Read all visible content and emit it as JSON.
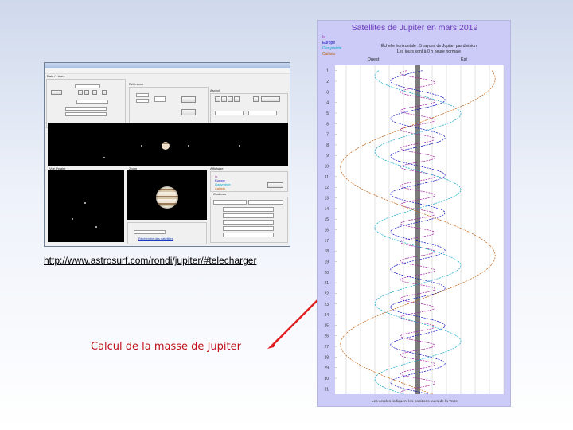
{
  "link": {
    "url_text": "http://www.astrosurf.com/rondi/jupiter/#telecharger"
  },
  "caption": {
    "text": "Calcul de la masse de Jupiter"
  },
  "arrow": {
    "color": "#e02020"
  },
  "software": {
    "tab_label": "Date / Heure",
    "group_ref": "Référence",
    "group_appearance": "Aspect",
    "pane_left": "Vue Polaire",
    "pane_right": "Zoom",
    "group_display": "Affichage",
    "legend_labels": [
      "Io",
      "Europe",
      "Ganymède",
      "Callisto"
    ],
    "legend_title": "Couleurs",
    "search_link": "Recherche des satellites",
    "field_values": [
      "31/01/2019",
      "17:00:00",
      "NIGHT VISION",
      "Réf. 23",
      "0.01 AU",
      "19h45mn",
      "6.89",
      "7.25",
      "0.9"
    ]
  },
  "chart": {
    "title": "Satellites de Jupiter en mars 2019",
    "legend": [
      {
        "label": "Io",
        "color": "#a020a0"
      },
      {
        "label": "Europe",
        "color": "#1010c0"
      },
      {
        "label": "Ganymède",
        "color": "#10a8c8"
      },
      {
        "label": "Callisto",
        "color": "#c06010"
      }
    ],
    "header_lines": [
      "Échelle horizontale : 5 rayons de Jupiter par division",
      "Les jours sont à 0 h heure normale"
    ],
    "axis_left_label": "Ouest",
    "axis_right_label": "Est",
    "days": [
      "1",
      "2",
      "3",
      "4",
      "5",
      "6",
      "7",
      "8",
      "9",
      "10",
      "11",
      "12",
      "13",
      "14",
      "15",
      "16",
      "17",
      "18",
      "19",
      "20",
      "21",
      "22",
      "23",
      "24",
      "25",
      "26",
      "27",
      "28",
      "29",
      "30",
      "31"
    ],
    "footer": "Les cercles indiquent les positions vues de la Terre"
  },
  "chart_data": {
    "type": "line",
    "title": "Satellites de Jupiter en mars 2019",
    "xlabel": "Ouest — Est",
    "ylabel": "",
    "x_units": "rayons de Jupiter",
    "y_units": "jour de mars 2019",
    "ylim": [
      1,
      31.5
    ],
    "series": [
      {
        "name": "Io",
        "color": "#a020a0",
        "amplitude": 6,
        "period_days": 1.77,
        "phase": 0.3
      },
      {
        "name": "Europe",
        "color": "#1010c0",
        "amplitude": 9.5,
        "period_days": 3.55,
        "phase": 1.2
      },
      {
        "name": "Ganymède",
        "color": "#10a8c8",
        "amplitude": 15,
        "period_days": 7.15,
        "phase": 3.4
      },
      {
        "name": "Callisto",
        "color": "#c06010",
        "amplitude": 27,
        "period_days": 16.69,
        "phase": 0.9
      }
    ]
  }
}
